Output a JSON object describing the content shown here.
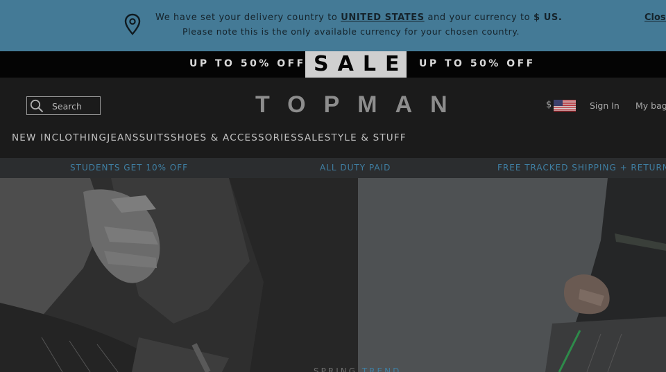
{
  "notice": {
    "text_before": "We have set your delivery country to",
    "country": "UNITED STATES",
    "text_middle": "and your currency to",
    "currency": "$ US.",
    "line2": "Please note this is the only available currency for your chosen country.",
    "close_label": "Close"
  },
  "sale_banner": {
    "promo_left": "UP TO 50% OFF",
    "sale_label": "SALE",
    "promo_right": "UP TO 50% OFF"
  },
  "header": {
    "search_placeholder": "Search",
    "logo": "TOPMAN",
    "currency_symbol": "$",
    "sign_in": "Sign In",
    "my_bag": "My bag"
  },
  "nav": {
    "items": [
      "NEW IN",
      "CLOTHING",
      "JEANS",
      "SUITS",
      "SHOES & ACCESSORIES",
      "SALE",
      "STYLE & STUFF"
    ]
  },
  "usp": {
    "students": "STUDENTS GET 10% OFF",
    "duty": "ALL DUTY PAID",
    "shipping": "FREE TRACKED SHIPPING + RETURNS"
  },
  "hero": {
    "caption_word1": "SPRING",
    "caption_word2": "TREND"
  },
  "colors": {
    "notice_bg": "#447a96",
    "accent_blue": "#3f7fa3",
    "header_bg": "#1b1b1b"
  }
}
